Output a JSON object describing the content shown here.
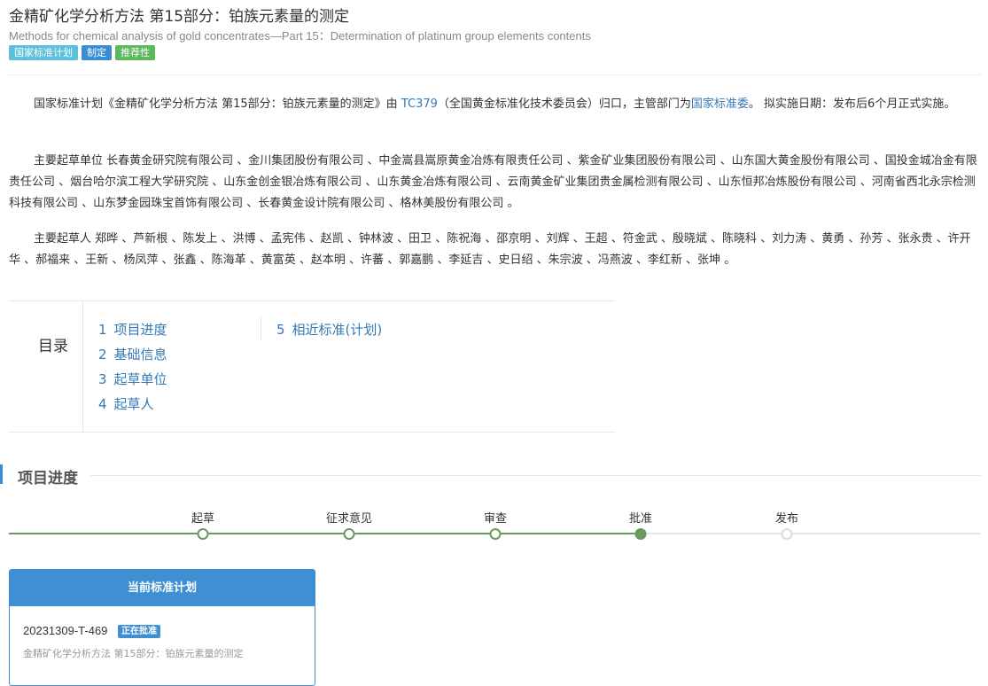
{
  "header": {
    "title": "金精矿化学分析方法 第15部分：铂族元素量的测定",
    "subtitle": "Methods for chemical analysis of gold concentrates—Part 15：Determination of platinum group elements contents",
    "badges": [
      {
        "label": "国家标准计划",
        "color": "#5bc0de"
      },
      {
        "label": "制定",
        "color": "#3a8cd7"
      },
      {
        "label": "推荐性",
        "color": "#5cb85c"
      }
    ]
  },
  "intro": {
    "p1_a": "国家标准计划《金精矿化学分析方法 第15部分：铂族元素量的测定》由 ",
    "p1_link1": "TC379",
    "p1_b": "（全国黄金标准化技术委员会）归口，主管部门为",
    "p1_link2": "国家标准委",
    "p1_c": "。 拟实施日期：发布后6个月正式实施。",
    "p2": "主要起草单位 长春黄金研究院有限公司 、金川集团股份有限公司 、中金嵩县嵩原黄金冶炼有限责任公司 、紫金矿业集团股份有限公司 、山东国大黄金股份有限公司 、国投金城冶金有限责任公司 、烟台哈尔滨工程大学研究院 、山东金创金银冶炼有限公司 、山东黄金冶炼有限公司 、云南黄金矿业集团贵金属检测有限公司 、山东恒邦冶炼股份有限公司 、河南省西北永宗检测科技有限公司 、山东梦金园珠宝首饰有限公司 、长春黄金设计院有限公司 、格林美股份有限公司 。",
    "p3": "主要起草人 郑晔 、芦新根 、陈发上 、洪博 、孟宪伟 、赵凯 、钟林波 、田卫 、陈祝海 、邵京明 、刘辉 、王超 、符金武 、殷晓斌 、陈晓科 、刘力涛 、黄勇 、孙芳 、张永贵 、许开华 、郝福来 、王新 、杨凤萍 、张鑫 、陈海革 、黄富英 、赵本明 、许蕃 、郭嘉鹏 、李延吉 、史日绍 、朱宗波 、冯燕波 、李红新 、张坤 。"
  },
  "toc": {
    "label": "目录",
    "items": [
      {
        "num": "1",
        "label": "项目进度"
      },
      {
        "num": "2",
        "label": "基础信息"
      },
      {
        "num": "3",
        "label": "起草单位"
      },
      {
        "num": "4",
        "label": "起草人"
      },
      {
        "num": "5",
        "label": "相近标准(计划)"
      }
    ]
  },
  "progress": {
    "section_title": "项目进度",
    "steps": [
      {
        "label": "起草",
        "state": "done"
      },
      {
        "label": "征求意见",
        "state": "done"
      },
      {
        "label": "审查",
        "state": "done"
      },
      {
        "label": "批准",
        "state": "current"
      },
      {
        "label": "发布",
        "state": "pending"
      }
    ],
    "accent": "#6b9a5e"
  },
  "current_plan": {
    "header": "当前标准计划",
    "code": "20231309-T-469",
    "status": "正在批准",
    "name": "金精矿化学分析方法 第15部分：铂族元素量的测定"
  }
}
